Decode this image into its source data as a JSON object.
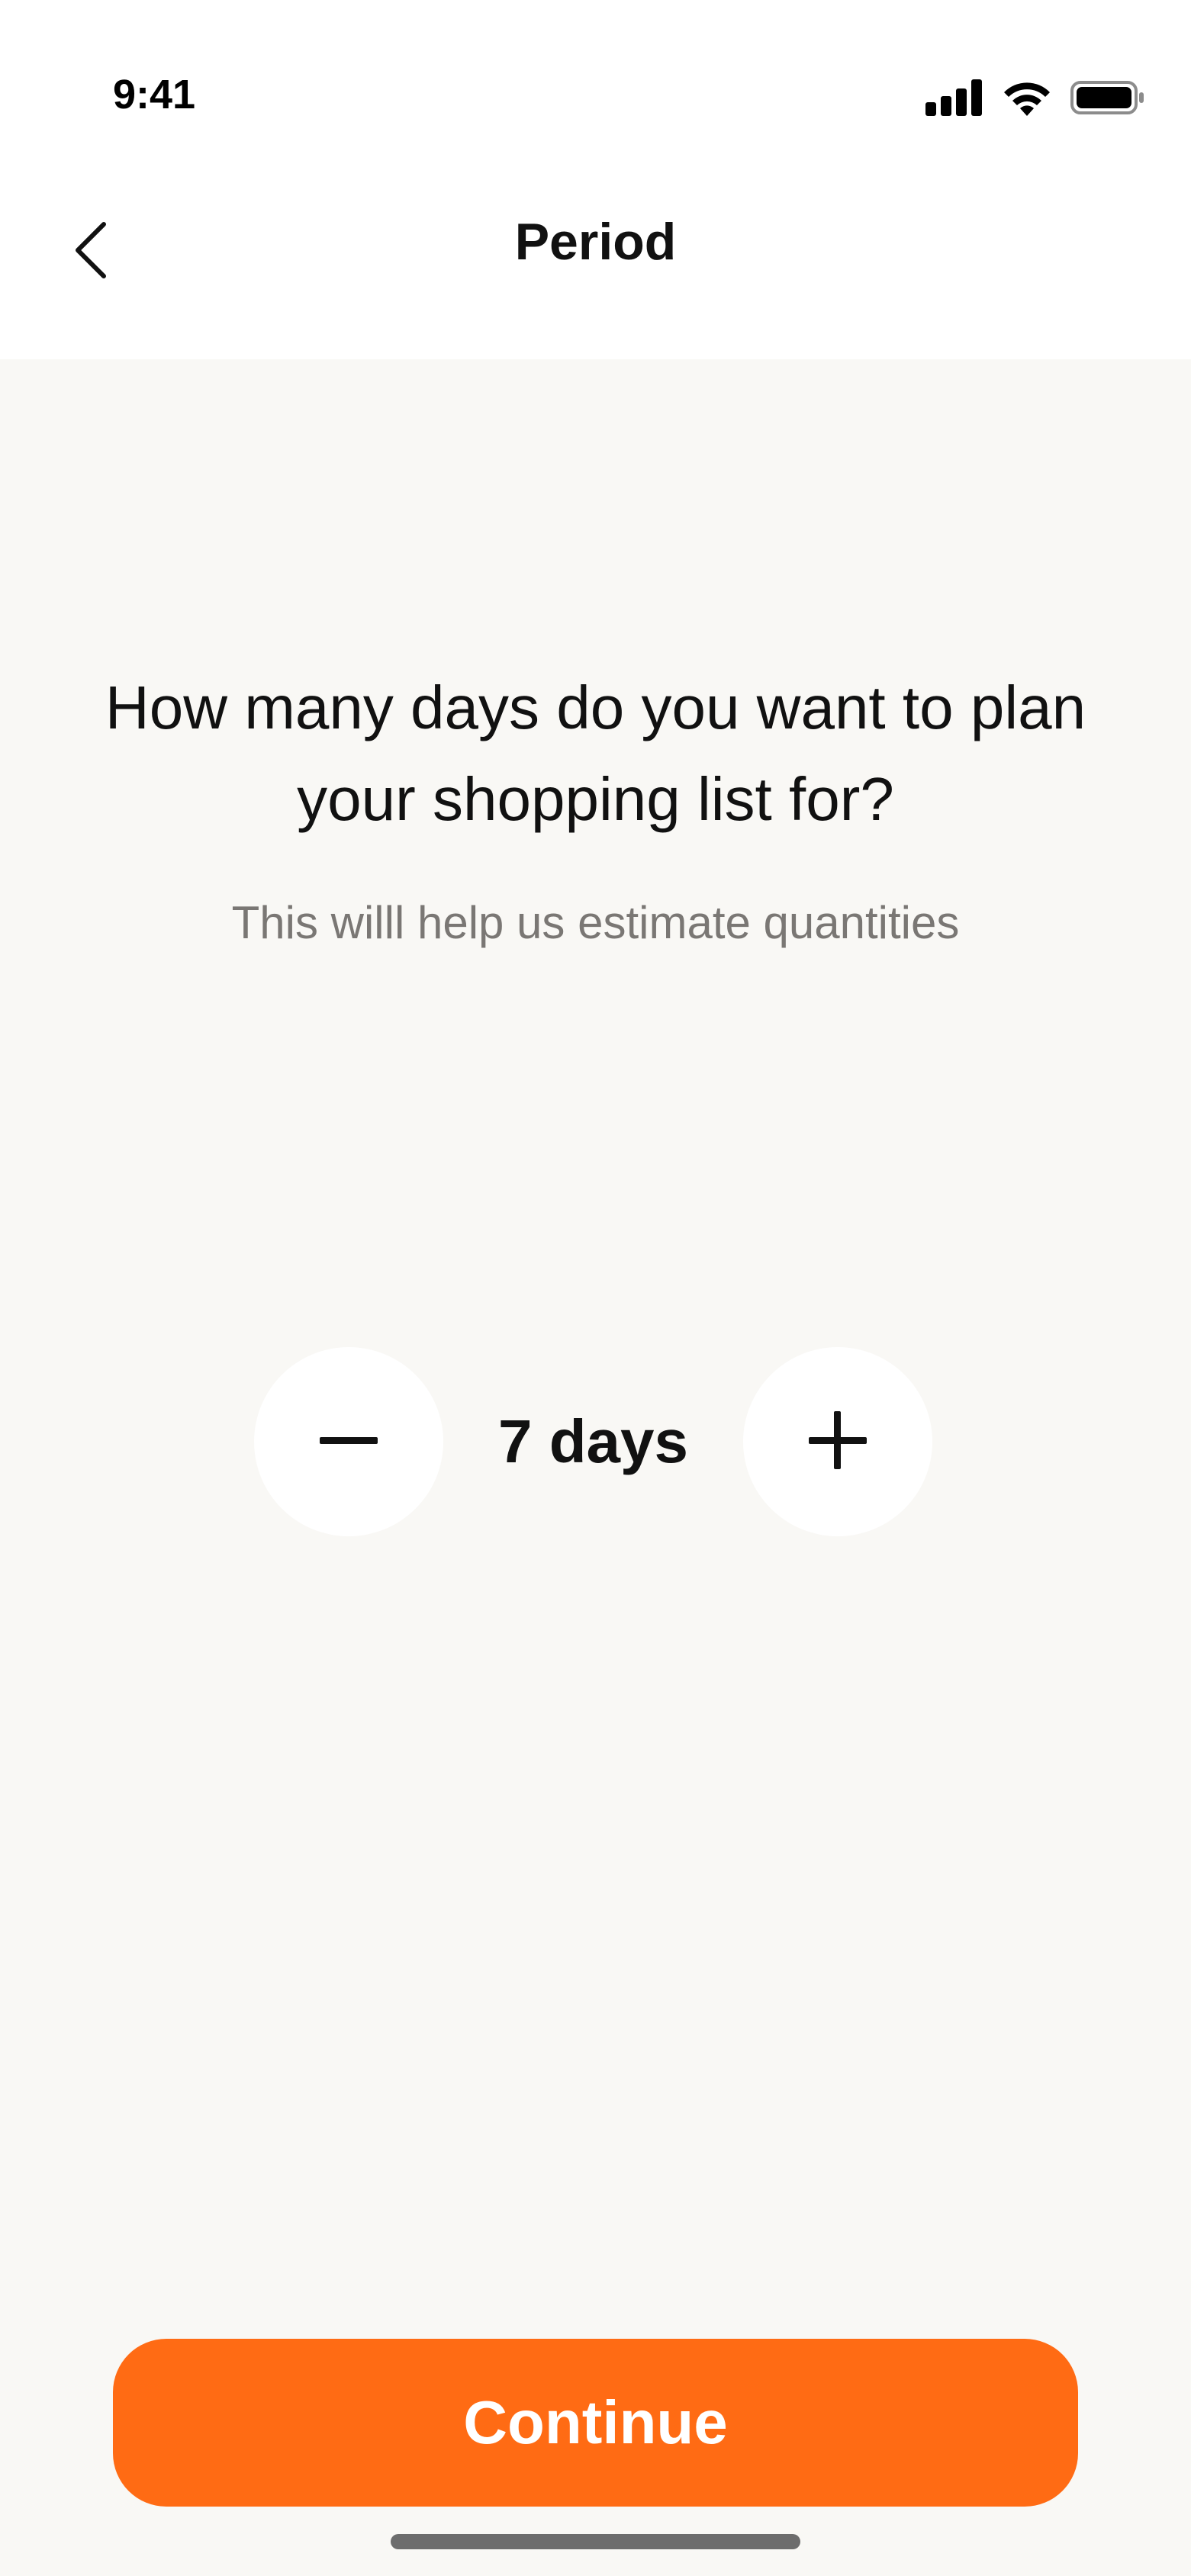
{
  "status_bar": {
    "time": "9:41",
    "icons": [
      "cellular-signal-icon",
      "wifi-icon",
      "battery-icon"
    ]
  },
  "nav": {
    "back_icon": "chevron-left-icon",
    "title": "Period"
  },
  "content": {
    "question": "How many days do you want to plan your shopping list for?",
    "subtitle": "This willl help us estimate quantities"
  },
  "stepper": {
    "value_label": "7 days",
    "value": 7,
    "decrement_icon": "minus-icon",
    "increment_icon": "plus-icon"
  },
  "footer": {
    "continue_label": "Continue"
  },
  "colors": {
    "accent": "#ff6b14",
    "background": "#f9f8f5",
    "header_background": "#ffffff",
    "subtitle_text": "#7a7774"
  }
}
